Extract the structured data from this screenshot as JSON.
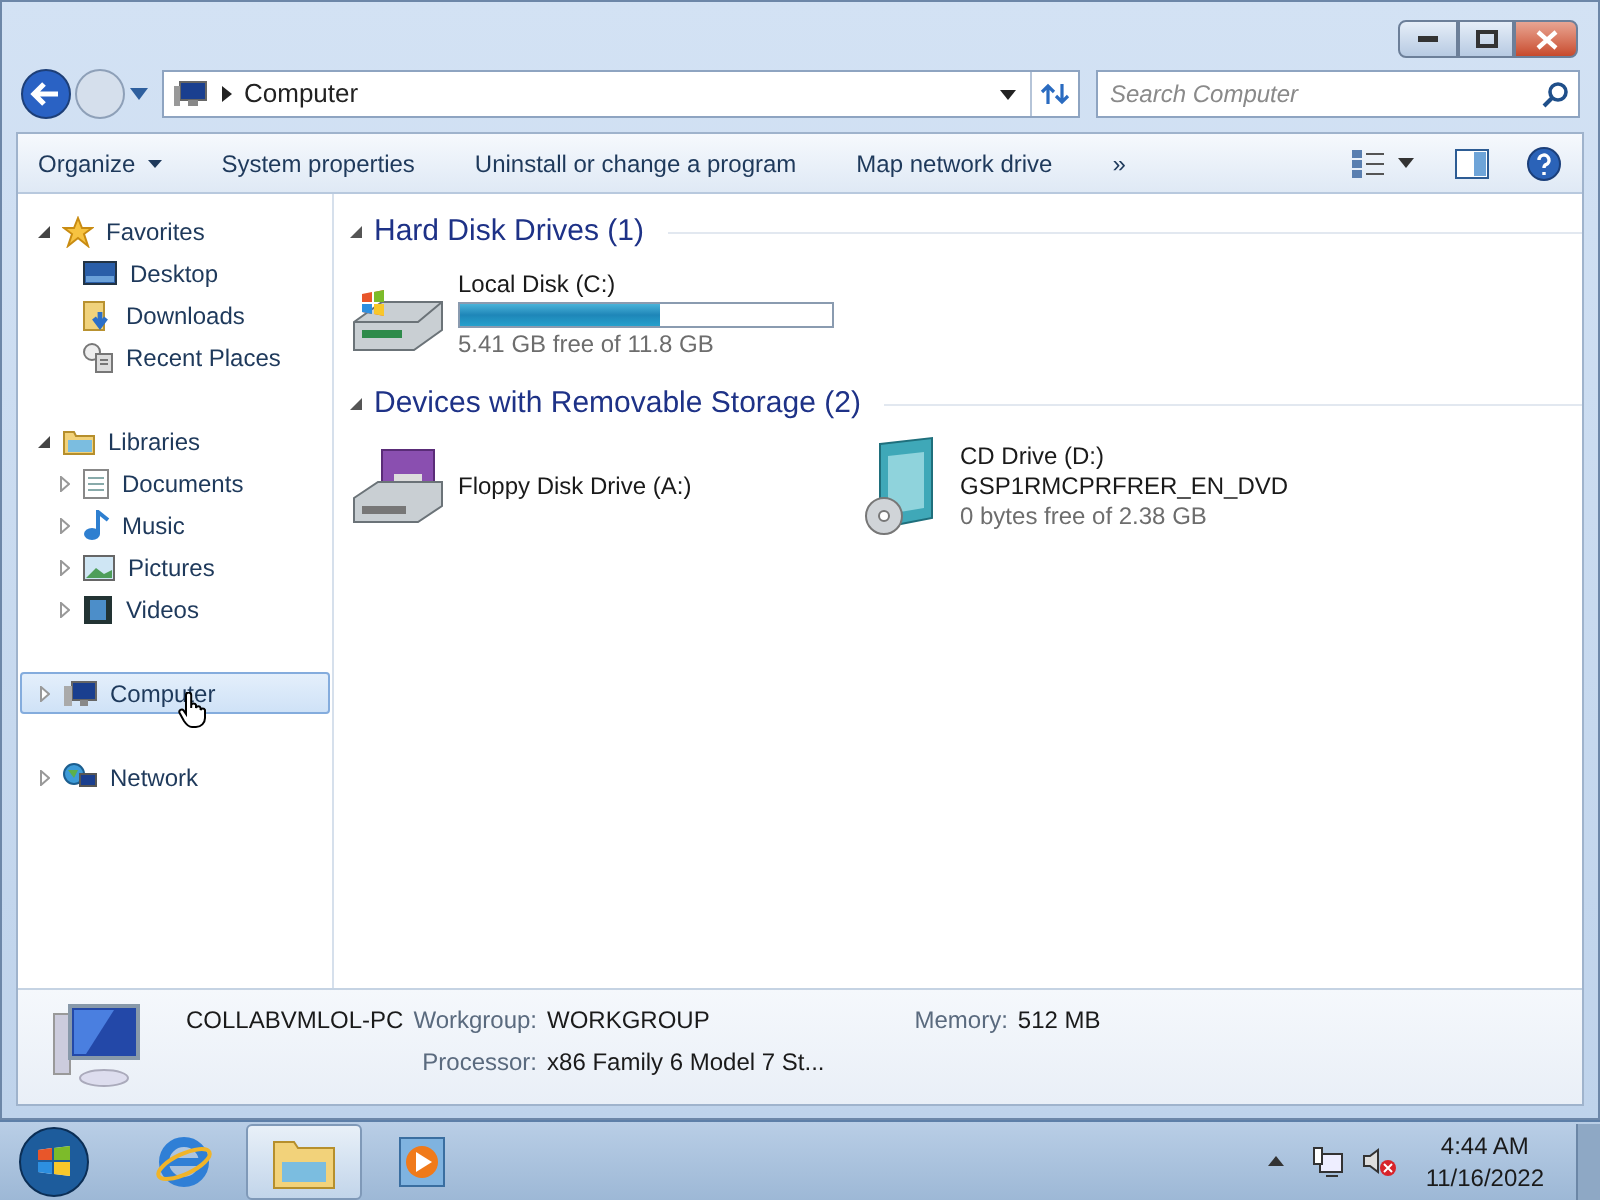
{
  "address": {
    "back_enabled": true,
    "forward_enabled": false,
    "breadcrumb": "Computer",
    "search_placeholder": "Search Computer"
  },
  "toolbar": {
    "buttons": [
      {
        "label": "Organize",
        "dropdown": true
      },
      {
        "label": "System properties",
        "dropdown": false
      },
      {
        "label": "Uninstall or change a program",
        "dropdown": false
      },
      {
        "label": "Map network drive",
        "dropdown": false
      },
      {
        "label": "»",
        "dropdown": false
      }
    ]
  },
  "navigation": [
    {
      "label": "Favorites",
      "expanded": true,
      "selected": false,
      "children": [
        {
          "label": "Desktop",
          "selected": false
        },
        {
          "label": "Downloads",
          "selected": false
        },
        {
          "label": "Recent Places",
          "selected": false
        }
      ]
    },
    {
      "label": "Libraries",
      "expanded": true,
      "selected": false,
      "children": [
        {
          "label": "Documents",
          "expanded": false,
          "selected": false
        },
        {
          "label": "Music",
          "expanded": false,
          "selected": false
        },
        {
          "label": "Pictures",
          "expanded": false,
          "selected": false
        },
        {
          "label": "Videos",
          "expanded": false,
          "selected": false
        }
      ]
    },
    {
      "label": "Computer",
      "expanded": false,
      "selected": true
    },
    {
      "label": "Network",
      "expanded": false,
      "selected": false
    }
  ],
  "groups": [
    {
      "title": "Hard Disk Drives (1)",
      "expanded": true,
      "items": [
        {
          "kind": "disk",
          "name": "Local Disk (C:)",
          "level": 0.54,
          "space": "5.41 GB free of 11.8 GB"
        }
      ]
    },
    {
      "title": "Devices with Removable Storage (2)",
      "expanded": true,
      "items": [
        {
          "kind": "floppy",
          "name": "Floppy Disk Drive (A:)"
        },
        {
          "kind": "cd",
          "name": "CD Drive (D:)",
          "volume": "GSP1RMCPRFRER_EN_DVD",
          "space": "0 bytes free of 2.38 GB"
        }
      ]
    }
  ],
  "details": {
    "name": "COLLABVMLOL-PC",
    "fields": [
      {
        "label": "Workgroup:",
        "value": "WORKGROUP"
      },
      {
        "label": "Memory:",
        "value": "512 MB"
      },
      {
        "label": "Processor:",
        "value": "x86 Family 6 Model 7 St..."
      }
    ]
  },
  "taskbar": {
    "apps": [
      {
        "kind": "ie",
        "selected": false
      },
      {
        "kind": "explorer",
        "selected": true
      },
      {
        "kind": "media",
        "selected": false
      }
    ],
    "time": "4:44 AM",
    "date": "11/16/2022"
  }
}
